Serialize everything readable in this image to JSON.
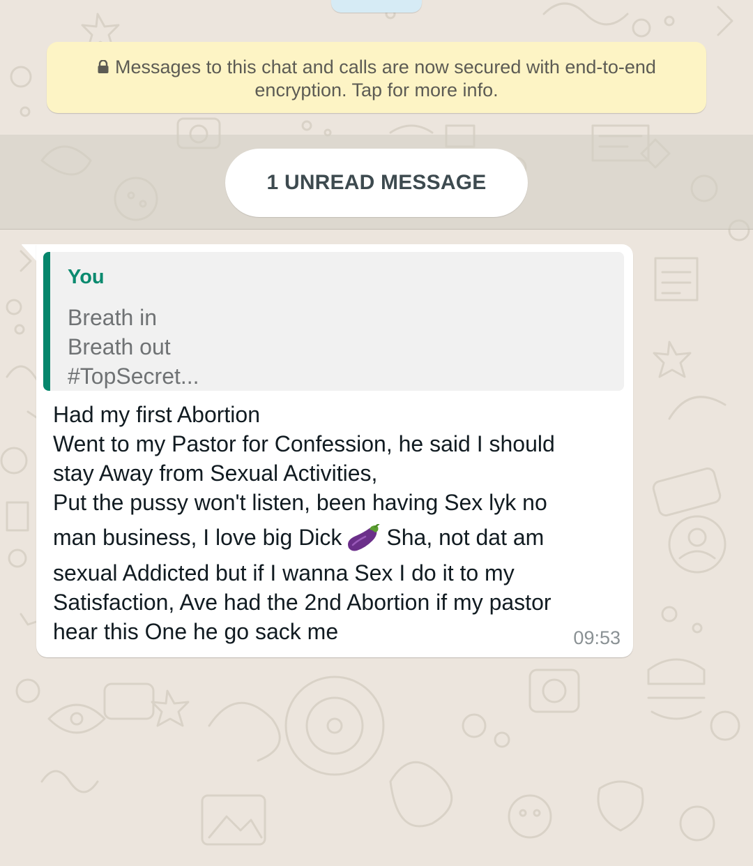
{
  "encryption_notice": {
    "line1": "Messages to this chat and calls are now secured with end-to-end",
    "line2": "encryption. Tap for more info."
  },
  "unread_banner": {
    "label": "1 UNREAD MESSAGE"
  },
  "message": {
    "quoted": {
      "author": "You",
      "lines": [
        "Breath in",
        "Breath out",
        "#TopSecret..."
      ]
    },
    "text_lines": [
      "Had my first Abortion",
      "Went to my Pastor for Confession, he said I should",
      "stay Away from Sexual Activities,",
      "Put the pussy won't listen, been having Sex lyk no",
      "man business, I love big Dick",
      "Sha, not dat am",
      "sexual Addicted but if I wanna Sex I do it to my",
      "Satisfaction, Ave had the 2nd Abortion if my pastor",
      "hear this One he go sack me"
    ],
    "emoji": "eggplant-icon",
    "time": "09:53"
  },
  "colors": {
    "wallpaper": "#ece5dd",
    "encryption_bg": "#fdf4c5",
    "quote_accent": "#06866c",
    "bubble_bg": "#ffffff"
  }
}
